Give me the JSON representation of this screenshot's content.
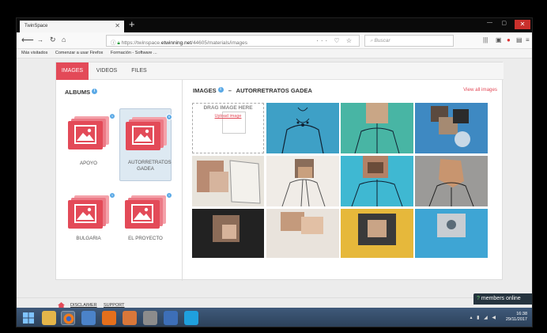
{
  "browser": {
    "tab_title": "TwinSpace",
    "url_prefix": "https://twinspace.",
    "url_domain": "etwinning.net",
    "url_path": "/44605/materials/images",
    "search_placeholder": "Buscar",
    "bookmarks": [
      "Más visitados",
      "Comenzar a usar Firefox",
      "Formación - Software ..."
    ]
  },
  "tabs": [
    {
      "label": "IMAGES",
      "active": true
    },
    {
      "label": "VIDEOS",
      "active": false
    },
    {
      "label": "FILES",
      "active": false
    }
  ],
  "albums_title": "ALBUMS",
  "albums": [
    {
      "label": "APOYO",
      "badge": "1"
    },
    {
      "label": "AUTORRETRATOS GADEA",
      "badge": "9",
      "selected": true
    },
    {
      "label": "BULGARIA",
      "badge": "1"
    },
    {
      "label": "EL PROYECTO",
      "badge": "1"
    }
  ],
  "images_title": "IMAGES",
  "album_title": "AUTORRETRATOS GADEA",
  "view_all": "View all images",
  "dropzone": {
    "heading": "DRAG IMAGE HERE",
    "link": "Upload image"
  },
  "footer": {
    "disclaimer": "DISCLAIMER",
    "support": "SUPPORT"
  },
  "members_online": "members online",
  "taskbar": {
    "time": "16:38",
    "date": "29/11/2017"
  },
  "colors": {
    "accent": "#e34a58",
    "info": "#5aa9e6"
  }
}
